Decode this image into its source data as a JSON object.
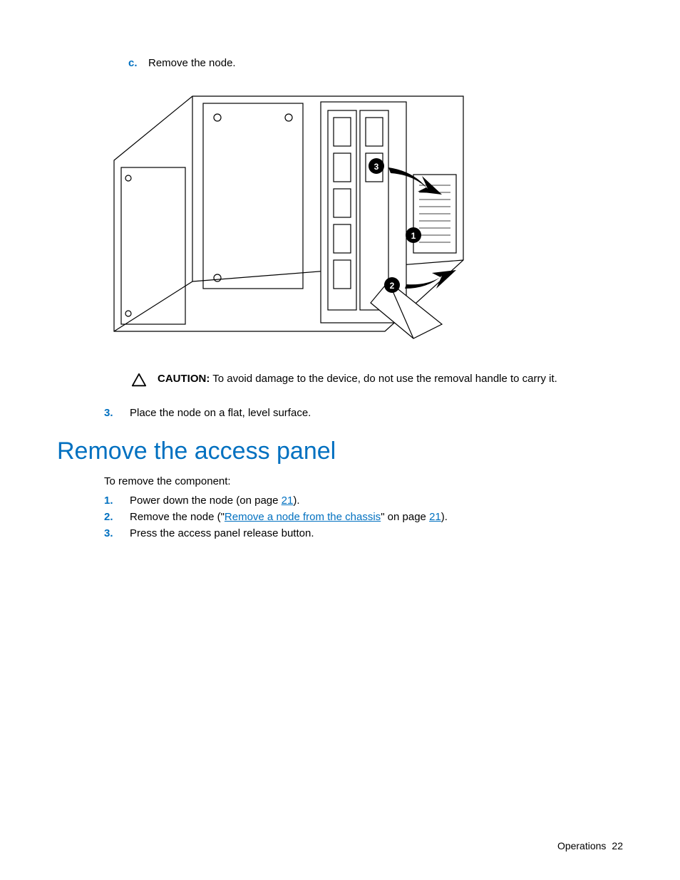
{
  "step_c": {
    "marker": "c.",
    "text": "Remove the node."
  },
  "caution": {
    "label": "CAUTION:",
    "text": "  To avoid damage to the device, do not use the removal handle to carry it."
  },
  "step_3_upper": {
    "marker": "3.",
    "text": "Place the node on a flat, level surface."
  },
  "heading": "Remove the access panel",
  "intro": "To remove the component:",
  "steps": [
    {
      "marker": "1.",
      "pre": "Power down the node (on page ",
      "link": "21",
      "post": ")."
    },
    {
      "marker": "2.",
      "pre": "Remove the node (\"",
      "link1": "Remove a node from the chassis",
      "mid": "\" on page ",
      "link2": "21",
      "post": ")."
    },
    {
      "marker": "3.",
      "pre": "Press the access panel release button."
    }
  ],
  "footer": {
    "section": "Operations",
    "page": "22"
  }
}
